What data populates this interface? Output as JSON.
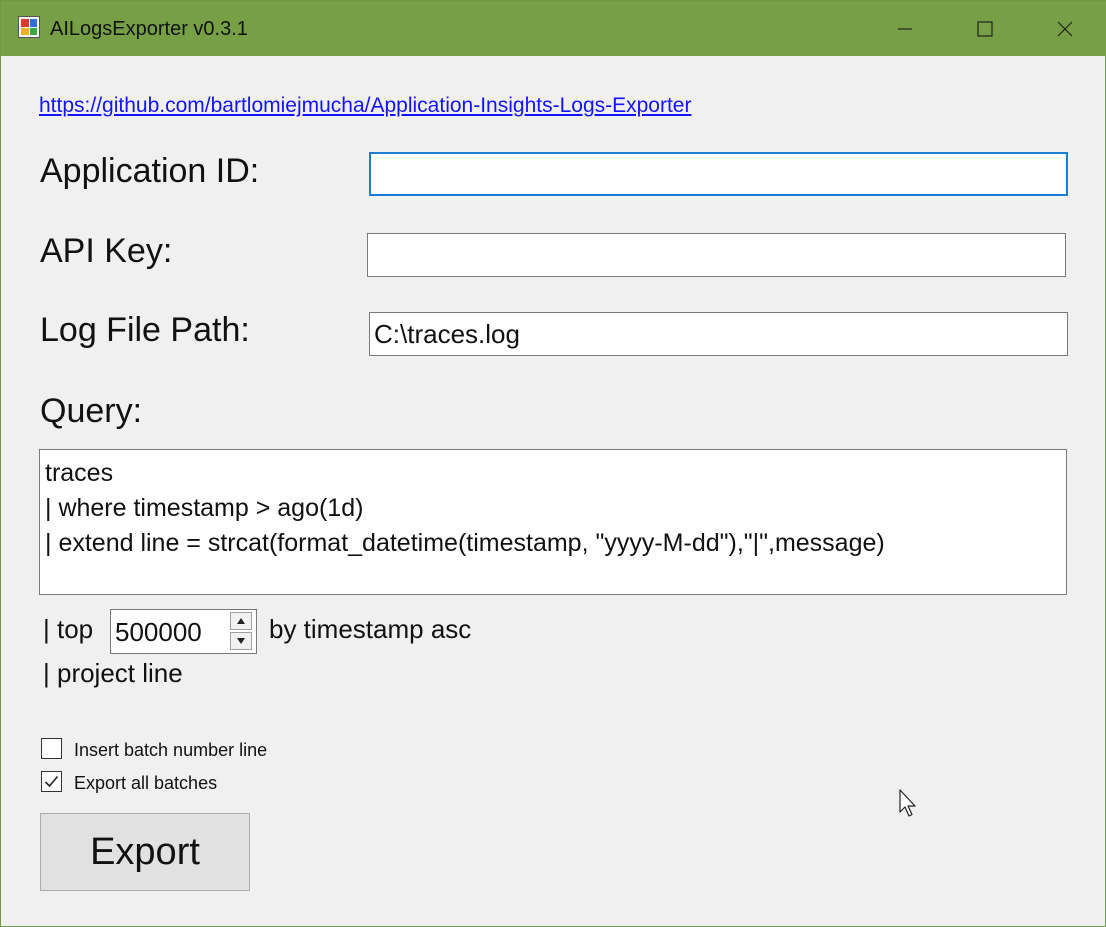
{
  "window": {
    "title": "AILogsExporter v0.3.1",
    "controls": {
      "minimize_icon": "minimize-icon",
      "maximize_icon": "maximize-icon",
      "close_icon": "close-icon"
    },
    "titlebar_color": "#77a046"
  },
  "form": {
    "github_link": "https://github.com/bartlomiejmucha/Application-Insights-Logs-Exporter",
    "application_id": {
      "label": "Application ID:",
      "value": ""
    },
    "api_key": {
      "label": "API Key:",
      "value": ""
    },
    "log_file_path": {
      "label": "Log File Path:",
      "value": "C:\\traces.log"
    },
    "query": {
      "label": "Query:",
      "lines": [
        "traces",
        "| where timestamp > ago(1d)",
        "| extend line = strcat(format_datetime(timestamp, \"yyyy-M-dd\"),\"|\",message)"
      ]
    },
    "top": {
      "prefix": "| top",
      "value": "500000",
      "suffix": "by timestamp asc"
    },
    "project_line": "| project line",
    "checkboxes": [
      {
        "label": "Insert batch number line",
        "checked": false
      },
      {
        "label": "Export all batches",
        "checked": true
      }
    ],
    "export_button": "Export"
  }
}
